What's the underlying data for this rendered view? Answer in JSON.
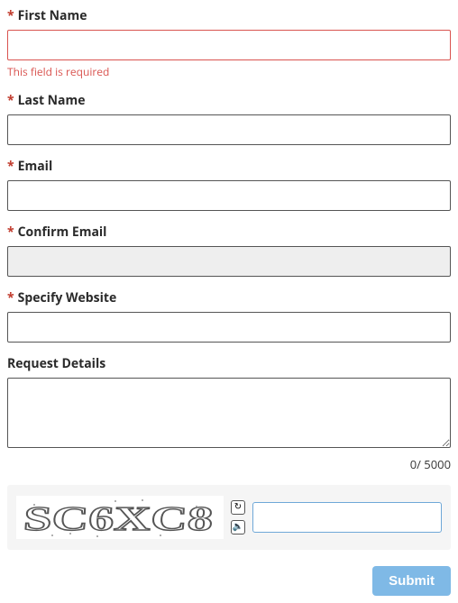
{
  "fields": {
    "first_name": {
      "label": "First Name",
      "value": "",
      "error": "This field is required"
    },
    "last_name": {
      "label": "Last Name",
      "value": ""
    },
    "email": {
      "label": "Email",
      "value": ""
    },
    "confirm_email": {
      "label": "Confirm Email",
      "value": ""
    },
    "website": {
      "label": "Specify Website",
      "value": ""
    },
    "details": {
      "label": "Request Details",
      "value": ""
    }
  },
  "required_marker": "*",
  "char_count": "0/ 5000",
  "captcha": {
    "text": "SC6XC8",
    "refresh_icon": "↻",
    "audio_icon": "🔈",
    "input_value": ""
  },
  "submit_label": "Submit"
}
